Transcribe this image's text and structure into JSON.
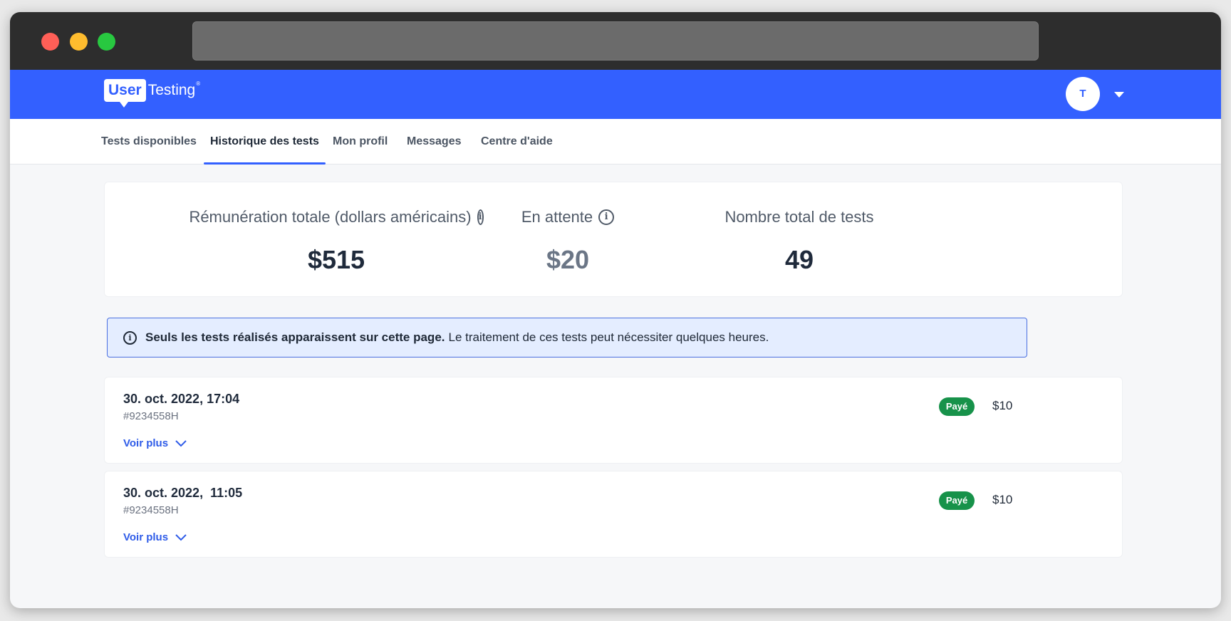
{
  "app": {
    "logo_part1": "User",
    "logo_part2": "Testing",
    "logo_reg": "®",
    "avatar_initial": "T"
  },
  "tabs": [
    {
      "label": "Tests disponibles",
      "active": false
    },
    {
      "label": "Historique des tests",
      "active": true
    },
    {
      "label": "Mon profil",
      "active": false
    },
    {
      "label": "Messages",
      "active": false
    },
    {
      "label": "Centre d'aide",
      "active": false
    }
  ],
  "summary": {
    "total": {
      "label": "Rémunération totale (dollars américains)",
      "value": "$515"
    },
    "pending": {
      "label": "En attente",
      "value": "$20"
    },
    "tests": {
      "label": "Nombre total de tests",
      "value": "49"
    }
  },
  "notice": {
    "icon": "info-icon",
    "bold": "Seuls les tests réalisés apparaissent sur cette page.",
    "text": "Le traitement de ces tests peut nécessiter quelques heures."
  },
  "tests": [
    {
      "date": "30. oct. 2022, 17:04",
      "id": "#9234558H",
      "more": "Voir plus",
      "status": "Payé",
      "amount": "$10"
    },
    {
      "date": "30. oct. 2022,  11:05",
      "id": "#9234558H",
      "more": "Voir plus",
      "status": "Payé",
      "amount": "$10"
    }
  ],
  "colors": {
    "brand": "#3360ff",
    "paid": "#17924a",
    "link": "#2f5ce8"
  }
}
